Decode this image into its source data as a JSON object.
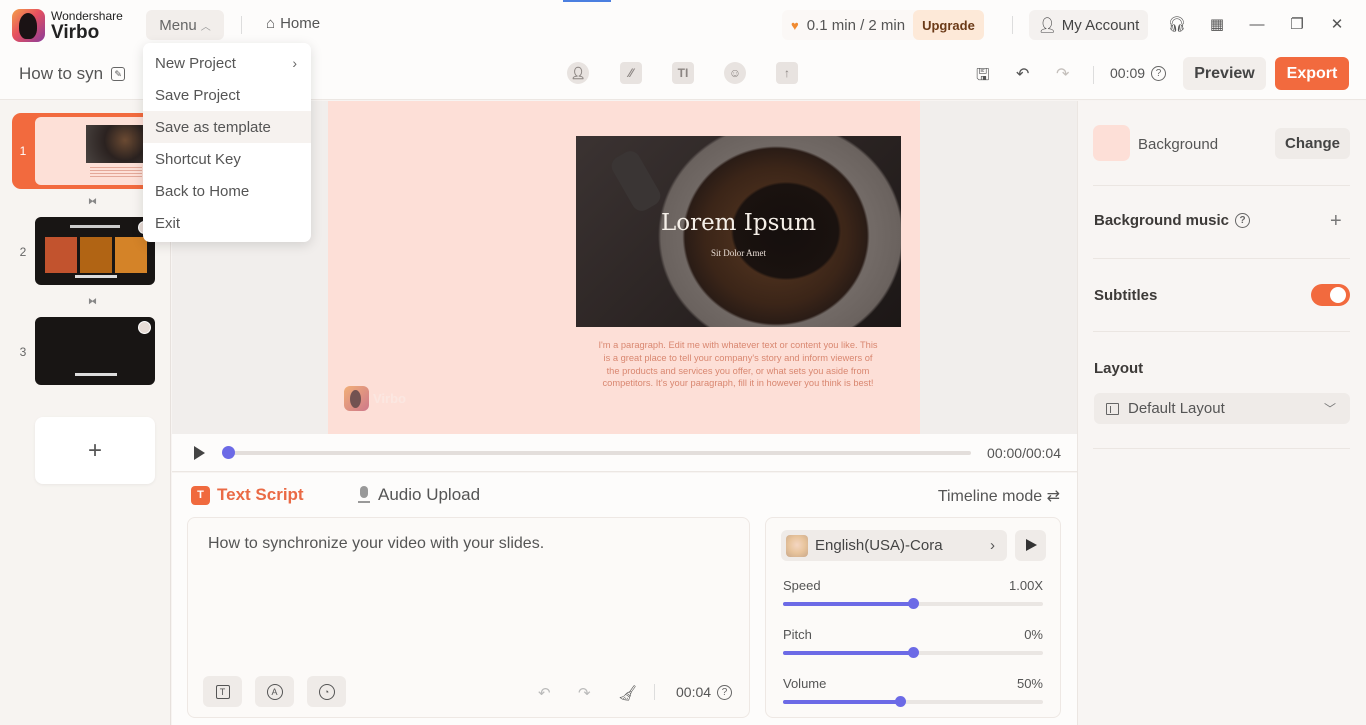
{
  "app": {
    "brand_small": "Wondershare",
    "brand_big": "Virbo"
  },
  "titlebar": {
    "menu_label": "Menu",
    "home_label": "Home",
    "usage_text": "0.1 min / 2 min",
    "upgrade_label": "Upgrade",
    "account_label": "My Account"
  },
  "menu": {
    "items": [
      {
        "label": "New Project",
        "has_submenu": true
      },
      {
        "label": "Save Project"
      },
      {
        "label": "Save as template"
      },
      {
        "label": "Shortcut Key"
      },
      {
        "label": "Back to Home"
      },
      {
        "label": "Exit"
      }
    ]
  },
  "toolbar": {
    "project_name": "How to syn",
    "tools": [
      "avatar-icon",
      "background-icon",
      "text-icon",
      "sticker-icon",
      "upload-icon"
    ],
    "duration": "00:09",
    "preview_label": "Preview",
    "export_label": "Export"
  },
  "slides": {
    "items": [
      {
        "number": "1",
        "active": true
      },
      {
        "number": "2",
        "active": false
      },
      {
        "number": "3",
        "active": false
      }
    ],
    "add_label": "+"
  },
  "canvas": {
    "title": "Lorem Ipsum",
    "subtitle": "Sit Dolor Amet",
    "paragraph": "I'm a paragraph. Edit me with whatever text or content you like. This is a great place to tell your company's story and inform viewers of the products and services you offer, or what sets you aside from competitors. It's your paragraph, fill it in however you think is best!",
    "watermark": "Virbo",
    "background_color": "#fddfd7"
  },
  "playback": {
    "time": "00:00/00:04",
    "progress": 0
  },
  "script": {
    "tab_text_label": "Text Script",
    "tab_audio_label": "Audio Upload",
    "timeline_mode_label": "Timeline mode ⇄",
    "text": "How to synchronize your video with your slides.",
    "duration": "00:04"
  },
  "voice": {
    "name": "English(USA)-Cora",
    "sliders": [
      {
        "label": "Speed",
        "value": "1.00X",
        "fraction": 0.5
      },
      {
        "label": "Pitch",
        "value": "0%",
        "fraction": 0.5
      },
      {
        "label": "Volume",
        "value": "50%",
        "fraction": 0.45
      }
    ]
  },
  "right_panel": {
    "background_label": "Background",
    "change_label": "Change",
    "background_music_label": "Background music",
    "subtitles_label": "Subtitles",
    "subtitles_on": true,
    "layout_label": "Layout",
    "layout_value": "Default Layout"
  },
  "colors": {
    "accent": "#f26a3e",
    "slider": "#6c6ae6"
  }
}
